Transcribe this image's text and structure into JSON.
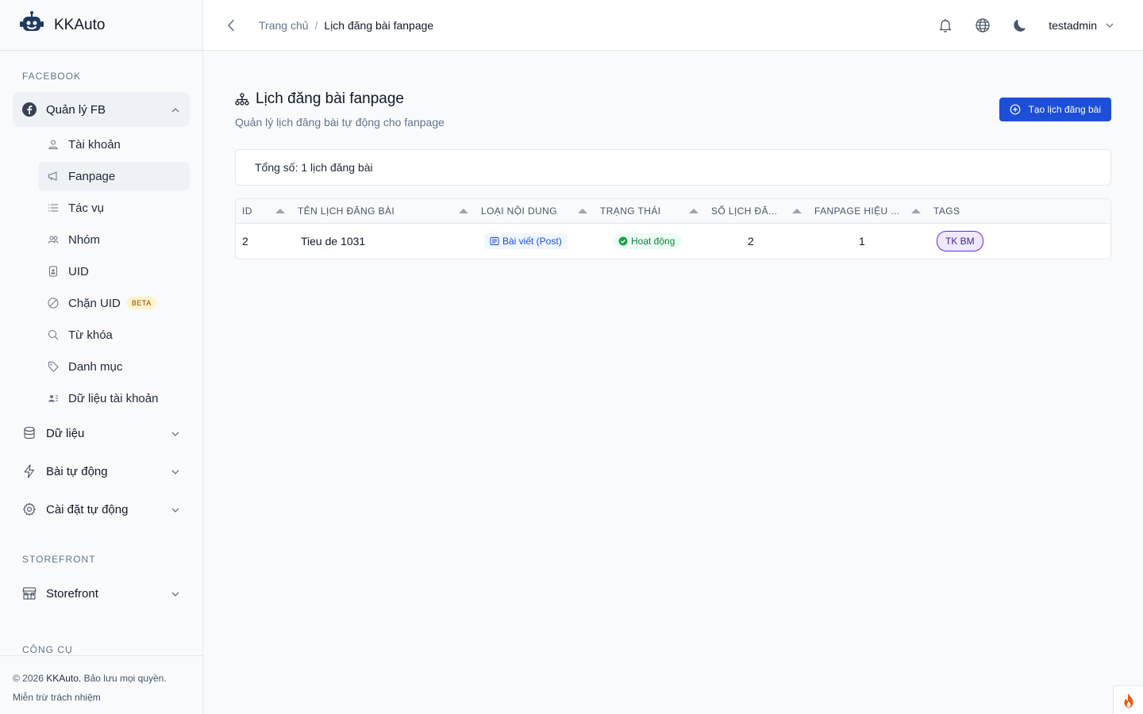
{
  "app": {
    "name": "KKAuto"
  },
  "sidebar": {
    "section_facebook": "FACEBOOK",
    "fb_group": {
      "label": "Quản lý FB"
    },
    "fb_items": [
      {
        "label": "Tài khoản"
      },
      {
        "label": "Fanpage"
      },
      {
        "label": "Tác vụ"
      },
      {
        "label": "Nhóm"
      },
      {
        "label": "UID"
      },
      {
        "label": "Chặn UID",
        "badge": "BETA"
      },
      {
        "label": "Từ khóa"
      },
      {
        "label": "Danh mục"
      },
      {
        "label": "Dữ liệu tài khoản"
      }
    ],
    "groups": [
      {
        "label": "Dữ liệu"
      },
      {
        "label": "Bài tự động"
      },
      {
        "label": "Cài đặt tự động"
      }
    ],
    "section_storefront": "STOREFRONT",
    "storefront": {
      "label": "Storefront"
    },
    "section_tools": "CÔNG CỤ",
    "footer": {
      "copyright_prefix": "© 2026",
      "brand": "KKAuto.",
      "rights": "Bảo lưu mọi quyền.",
      "disclaimer": "Miễn trừ trách nhiệm"
    }
  },
  "header": {
    "breadcrumb_home": "Trang chủ",
    "breadcrumb_sep": "/",
    "breadcrumb_current": "Lịch đăng bài fanpage",
    "username": "testadmin"
  },
  "page": {
    "title": "Lịch đăng bài fanpage",
    "subtitle": "Quản lý lịch đăng bài tự động cho fanpage",
    "create_button": "Tạo lịch đăng bài",
    "summary": "Tổng số: 1 lịch đăng bài"
  },
  "table": {
    "columns": [
      "ID",
      "TÊN LỊCH ĐĂNG BÀI",
      "LOẠI NỘI DUNG",
      "TRẠNG THÁI",
      "SỐ LỊCH ĐĂ...",
      "FANPAGE HIỆU ...",
      "TAGS"
    ],
    "rows": [
      {
        "id": "2",
        "name": "Tieu de 1031",
        "content_type": "Bài viết (Post)",
        "status": "Hoạt động",
        "schedule_count": "2",
        "fanpage_count": "1",
        "tag": "TK BM"
      }
    ]
  },
  "colors": {
    "primary": "#1d4ed8",
    "status_active": "#15803d",
    "tag_border": "#6d28d9"
  }
}
